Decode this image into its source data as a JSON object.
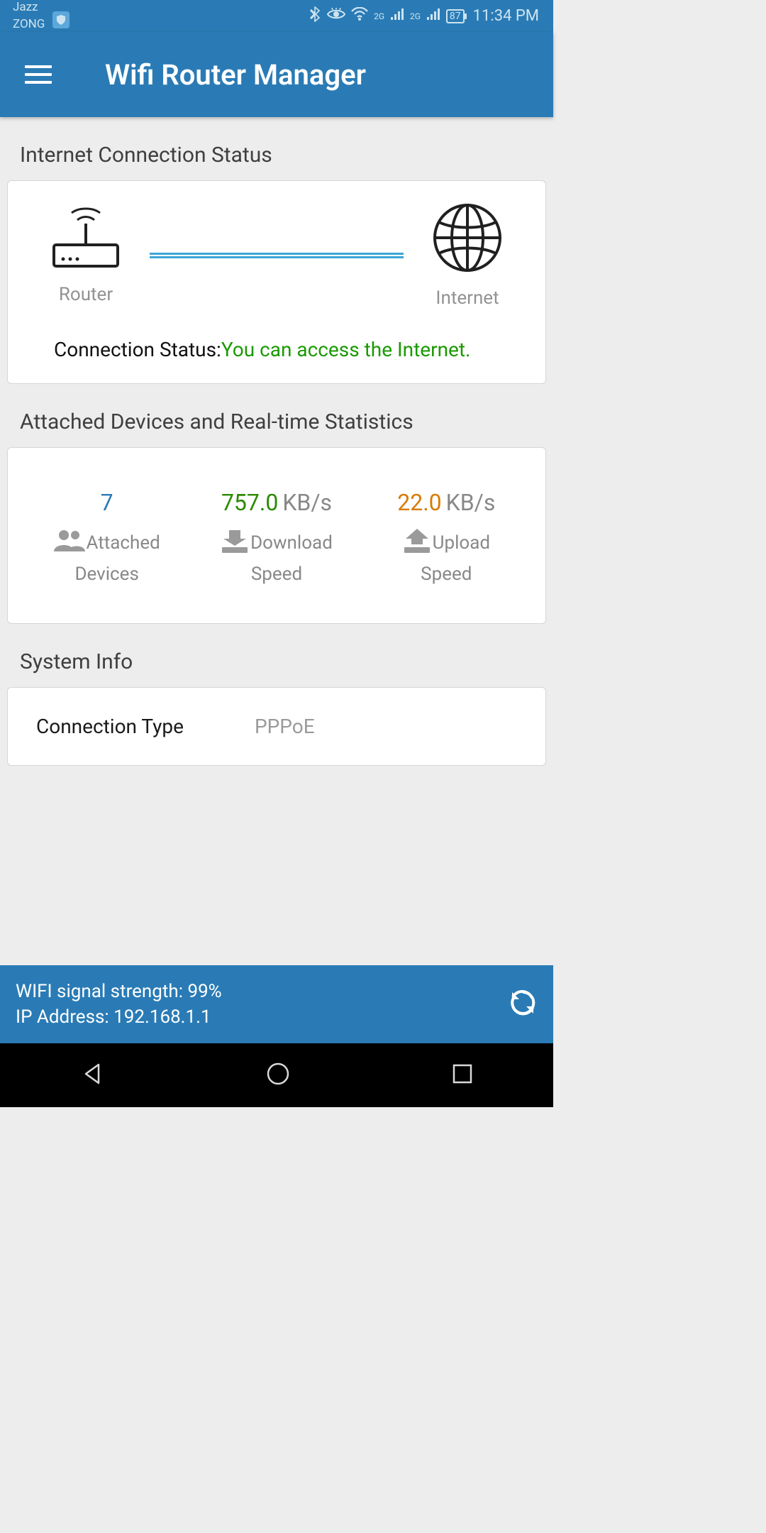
{
  "status_bar": {
    "carrier1": "Jazz",
    "carrier2": "ZONG",
    "network_badge": "2G",
    "battery": "87",
    "time": "11:34 PM"
  },
  "app_bar": {
    "title": "Wifi Router Manager"
  },
  "sections": {
    "connection": {
      "title": "Internet Connection Status",
      "router_label": "Router",
      "internet_label": "Internet",
      "status_label": "Connection Status:",
      "status_value": "You can access the Internet."
    },
    "stats": {
      "title": "Attached Devices and Real-time Statistics",
      "attached_value": "7",
      "attached_label1": "Attached",
      "attached_label2": "Devices",
      "download_value": "757.0",
      "download_unit": "KB/s",
      "download_label1": "Download",
      "download_label2": "Speed",
      "upload_value": "22.0",
      "upload_unit": "KB/s",
      "upload_label1": "Upload",
      "upload_label2": "Speed"
    },
    "system": {
      "title": "System Info",
      "connection_type_label": "Connection Type",
      "connection_type_value": "PPPoE"
    }
  },
  "footer": {
    "wifi_strength": "WIFI signal strength: 99%",
    "ip": "IP Address: 192.168.1.1"
  }
}
